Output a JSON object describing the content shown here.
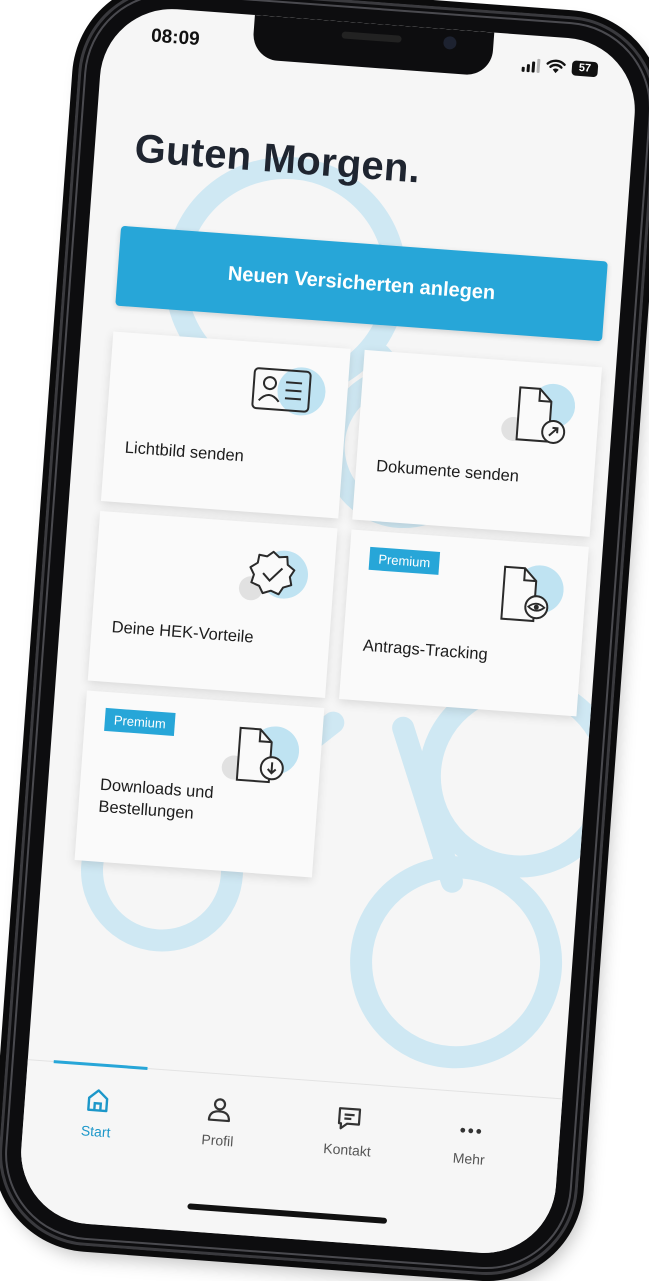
{
  "status_bar": {
    "time": "08:09",
    "battery_level": "57",
    "icons": [
      "signal-bars-icon",
      "wifi-icon",
      "battery-icon"
    ]
  },
  "greeting": "Guten Morgen.",
  "cta": {
    "label": "Neuen Versicherten anlegen"
  },
  "tiles": [
    {
      "label": "Lichtbild senden",
      "icon": "id-card-icon",
      "badge": ""
    },
    {
      "label": "Dokumente senden",
      "icon": "document-send-icon",
      "badge": ""
    },
    {
      "label": "Deine HEK-Vorteile",
      "icon": "verified-badge-icon",
      "badge": ""
    },
    {
      "label": "Antrags-Tracking",
      "icon": "document-eye-icon",
      "badge": "Premium"
    },
    {
      "label": "Downloads und Bestellungen",
      "icon": "document-download-icon",
      "badge": "Premium"
    }
  ],
  "bottom_nav": {
    "active": "Start",
    "items": [
      {
        "label": "Start",
        "icon": "home-icon"
      },
      {
        "label": "Profil",
        "icon": "person-icon"
      },
      {
        "label": "Kontakt",
        "icon": "chat-icon"
      },
      {
        "label": "Mehr",
        "icon": "more-dots-icon"
      }
    ]
  },
  "colors": {
    "accent": "#27a6d8",
    "background": "#f6f6f6",
    "tile": "#fafafa",
    "text": "#1f2530",
    "decor": "#bfe3f2"
  }
}
